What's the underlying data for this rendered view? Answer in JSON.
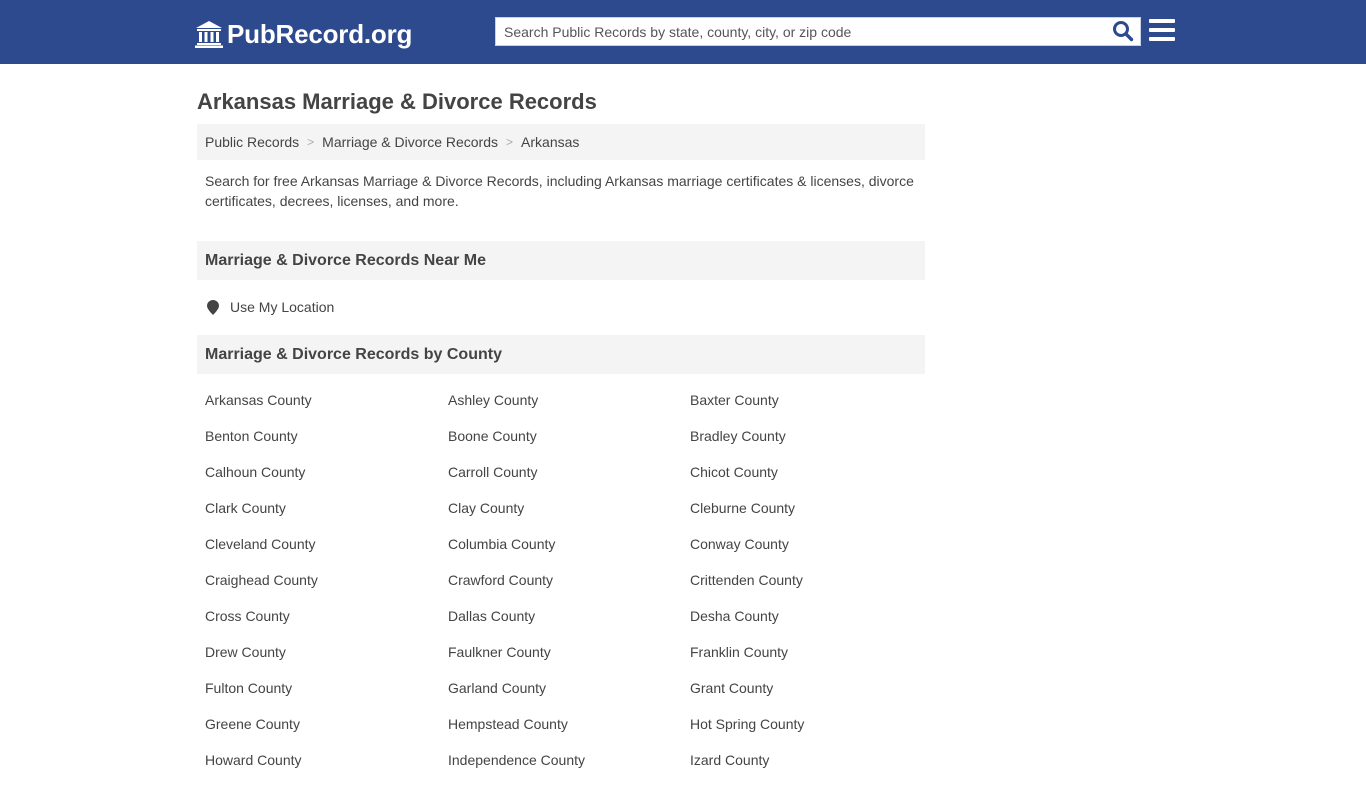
{
  "header": {
    "logo_text": "PubRecord.org",
    "search_placeholder": "Search Public Records by state, county, city, or zip code",
    "search_value": "",
    "brand_color": "#2e4a8f",
    "search_icon": "search-icon",
    "menu_icon": "hamburger-menu-icon"
  },
  "page": {
    "title": "Arkansas Marriage & Divorce Records",
    "breadcrumb": [
      {
        "label": "Public Records"
      },
      {
        "label": "Marriage & Divorce Records"
      },
      {
        "label": "Arkansas"
      }
    ],
    "breadcrumb_separator": ">",
    "intro": "Search for free Arkansas Marriage & Divorce Records, including Arkansas marriage certificates & licenses, divorce certificates, decrees, licenses, and more."
  },
  "near_me": {
    "heading": "Marriage & Divorce Records Near Me",
    "location_label": "Use My Location",
    "location_icon": "map-pin-icon"
  },
  "by_county": {
    "heading": "Marriage & Divorce Records by County",
    "counties": [
      "Arkansas County",
      "Ashley County",
      "Baxter County",
      "Benton County",
      "Boone County",
      "Bradley County",
      "Calhoun County",
      "Carroll County",
      "Chicot County",
      "Clark County",
      "Clay County",
      "Cleburne County",
      "Cleveland County",
      "Columbia County",
      "Conway County",
      "Craighead County",
      "Crawford County",
      "Crittenden County",
      "Cross County",
      "Dallas County",
      "Desha County",
      "Drew County",
      "Faulkner County",
      "Franklin County",
      "Fulton County",
      "Garland County",
      "Grant County",
      "Greene County",
      "Hempstead County",
      "Hot Spring County",
      "Howard County",
      "Independence County",
      "Izard County"
    ]
  }
}
